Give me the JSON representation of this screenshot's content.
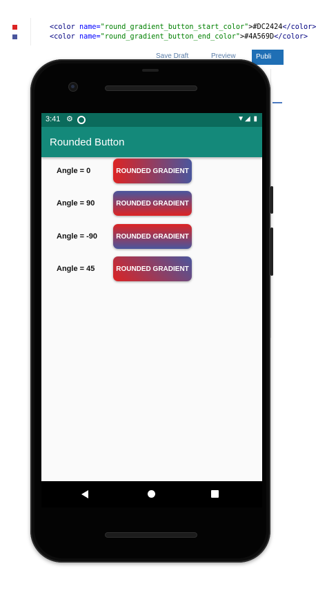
{
  "code": {
    "start_swatch_color": "#DC2424",
    "end_swatch_color": "#4A569D",
    "line1": {
      "open": "<color ",
      "attr": "name=",
      "name": "\"round_gradient_button_start_color\"",
      "value": ">#DC2424",
      "close": "</color>"
    },
    "line2": {
      "open": "<color ",
      "attr": "name=",
      "name": "\"round_gradient_button_end_color\"",
      "value": ">#4A569D",
      "close": "</color>"
    }
  },
  "background_editor": {
    "save_draft": "Save Draft",
    "preview": "Preview",
    "publish": "Publi"
  },
  "status_bar": {
    "time": "3:41",
    "settings_icon": "gear-icon",
    "sync_icon": "sync-icon",
    "right_icons": "▼◢ ▮"
  },
  "app_bar": {
    "title": "Rounded Button",
    "color": "#14897a"
  },
  "rows": [
    {
      "label": "Angle = 0",
      "button": "ROUNDED GRADIENT",
      "angle": 0
    },
    {
      "label": "Angle = 90",
      "button": "ROUNDED GRADIENT",
      "angle": 90
    },
    {
      "label": "Angle = -90",
      "button": "ROUNDED GRADIENT",
      "angle": -90
    },
    {
      "label": "Angle = 45",
      "button": "ROUNDED GRADIENT",
      "angle": 45
    }
  ],
  "gradient": {
    "start_color": "#DC2424",
    "end_color": "#4A569D"
  },
  "nav_bar": {
    "back_icon": "back-triangle-icon",
    "home_icon": "home-circle-icon",
    "recents_icon": "recents-square-icon"
  }
}
